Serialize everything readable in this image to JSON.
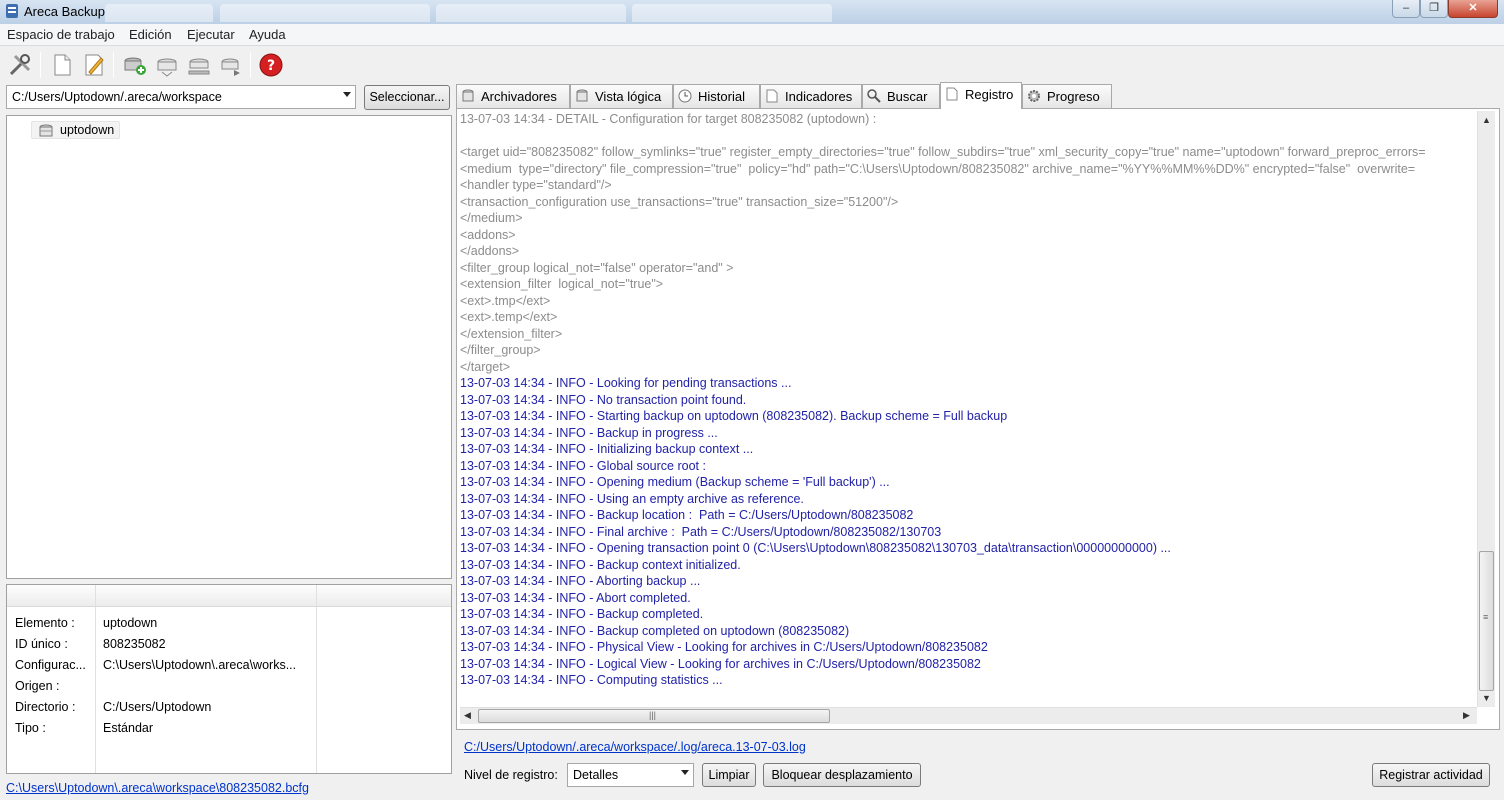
{
  "window": {
    "title": "Areca Backup"
  },
  "menu": [
    "Espacio de trabajo",
    "Edición",
    "Ejecutar",
    "Ayuda"
  ],
  "toolbar": {
    "icons": [
      "tools-icon",
      "new-document-icon",
      "edit-icon",
      "add-archive-icon",
      "archive-icon",
      "archive-tray-icon",
      "archive-run-icon",
      "help-icon"
    ]
  },
  "workspace": {
    "path": "C:/Users/Uptodown/.areca/workspace",
    "select_label": "Seleccionar..."
  },
  "tree": {
    "items": [
      {
        "label": "uptodown"
      }
    ]
  },
  "properties": {
    "rows": [
      {
        "key": "Elemento :",
        "value": "uptodown"
      },
      {
        "key": "ID único :",
        "value": "808235082"
      },
      {
        "key": "Configurac...",
        "value": "C:\\Users\\Uptodown\\.areca\\works..."
      },
      {
        "key": "Origen :",
        "value": ""
      },
      {
        "key": "Directorio :",
        "value": "C:/Users/Uptodown"
      },
      {
        "key": "Tipo :",
        "value": "Estándar"
      }
    ]
  },
  "config_file_link": "C:\\Users\\Uptodown\\.areca\\workspace\\808235082.bcfg",
  "tabs": [
    {
      "label": "Archivadores",
      "icon": "archive-icon"
    },
    {
      "label": "Vista lógica",
      "icon": "archive-icon"
    },
    {
      "label": "Historial",
      "icon": "clock-icon"
    },
    {
      "label": "Indicadores",
      "icon": "document-icon"
    },
    {
      "label": "Buscar",
      "icon": "magnifier-icon"
    },
    {
      "label": "Registro",
      "icon": "document-icon",
      "active": true
    },
    {
      "label": "Progreso",
      "icon": "gear-icon"
    }
  ],
  "log": {
    "lines": [
      {
        "level": "detail",
        "text": "13-07-03 14:34 - DETAIL - Configuration for target 808235082 (uptodown) :"
      },
      {
        "level": "detail",
        "text": ""
      },
      {
        "level": "detail",
        "text": "<target uid=\"808235082\" follow_symlinks=\"true\" register_empty_directories=\"true\" follow_subdirs=\"true\" xml_security_copy=\"true\" name=\"uptodown\" forward_preproc_errors="
      },
      {
        "level": "detail",
        "text": "<medium  type=\"directory\" file_compression=\"true\"  policy=\"hd\" path=\"C:\\Users\\Uptodown/808235082\" archive_name=\"%YY%%MM%%DD%\" encrypted=\"false\"  overwrite="
      },
      {
        "level": "detail",
        "text": "<handler type=\"standard\"/>"
      },
      {
        "level": "detail",
        "text": "<transaction_configuration use_transactions=\"true\" transaction_size=\"51200\"/>"
      },
      {
        "level": "detail",
        "text": "</medium>"
      },
      {
        "level": "detail",
        "text": "<addons>"
      },
      {
        "level": "detail",
        "text": "</addons>"
      },
      {
        "level": "detail",
        "text": "<filter_group logical_not=\"false\" operator=\"and\" >"
      },
      {
        "level": "detail",
        "text": "<extension_filter  logical_not=\"true\">"
      },
      {
        "level": "detail",
        "text": "<ext>.tmp</ext>"
      },
      {
        "level": "detail",
        "text": "<ext>.temp</ext>"
      },
      {
        "level": "detail",
        "text": "</extension_filter>"
      },
      {
        "level": "detail",
        "text": "</filter_group>"
      },
      {
        "level": "detail",
        "text": "</target>"
      },
      {
        "level": "info",
        "text": "13-07-03 14:34 - INFO - Looking for pending transactions ..."
      },
      {
        "level": "info",
        "text": "13-07-03 14:34 - INFO - No transaction point found."
      },
      {
        "level": "info",
        "text": "13-07-03 14:34 - INFO - Starting backup on uptodown (808235082). Backup scheme = Full backup"
      },
      {
        "level": "info",
        "text": "13-07-03 14:34 - INFO - Backup in progress ..."
      },
      {
        "level": "info",
        "text": "13-07-03 14:34 - INFO - Initializing backup context ..."
      },
      {
        "level": "info",
        "text": "13-07-03 14:34 - INFO - Global source root :"
      },
      {
        "level": "info",
        "text": "13-07-03 14:34 - INFO - Opening medium (Backup scheme = 'Full backup') ..."
      },
      {
        "level": "info",
        "text": "13-07-03 14:34 - INFO - Using an empty archive as reference."
      },
      {
        "level": "info",
        "text": "13-07-03 14:34 - INFO - Backup location :  Path = C:/Users/Uptodown/808235082"
      },
      {
        "level": "info",
        "text": "13-07-03 14:34 - INFO - Final archive :  Path = C:/Users/Uptodown/808235082/130703"
      },
      {
        "level": "info",
        "text": "13-07-03 14:34 - INFO - Opening transaction point 0 (C:\\Users\\Uptodown\\808235082\\130703_data\\transaction\\00000000000) ..."
      },
      {
        "level": "info",
        "text": "13-07-03 14:34 - INFO - Backup context initialized."
      },
      {
        "level": "info",
        "text": "13-07-03 14:34 - INFO - Aborting backup ..."
      },
      {
        "level": "info",
        "text": "13-07-03 14:34 - INFO - Abort completed."
      },
      {
        "level": "info",
        "text": "13-07-03 14:34 - INFO - Backup completed."
      },
      {
        "level": "info",
        "text": "13-07-03 14:34 - INFO - Backup completed on uptodown (808235082)"
      },
      {
        "level": "info",
        "text": "13-07-03 14:34 - INFO - Physical View - Looking for archives in C:/Users/Uptodown/808235082"
      },
      {
        "level": "info",
        "text": "13-07-03 14:34 - INFO - Logical View - Looking for archives in C:/Users/Uptodown/808235082"
      },
      {
        "level": "info",
        "text": "13-07-03 14:34 - INFO - Computing statistics ..."
      }
    ],
    "file_link": "C:/Users/Uptodown/.areca/workspace/.log/areca.13-07-03.log"
  },
  "log_controls": {
    "level_label": "Nivel de registro:",
    "level_value": "Detalles",
    "clear_label": "Limpiar",
    "lock_scroll_label": "Bloquear desplazamiento",
    "register_activity_label": "Registrar actividad"
  },
  "colors": {
    "log_detail": "#8c8c8c",
    "log_info": "#2222a8",
    "link": "#0033cc"
  }
}
